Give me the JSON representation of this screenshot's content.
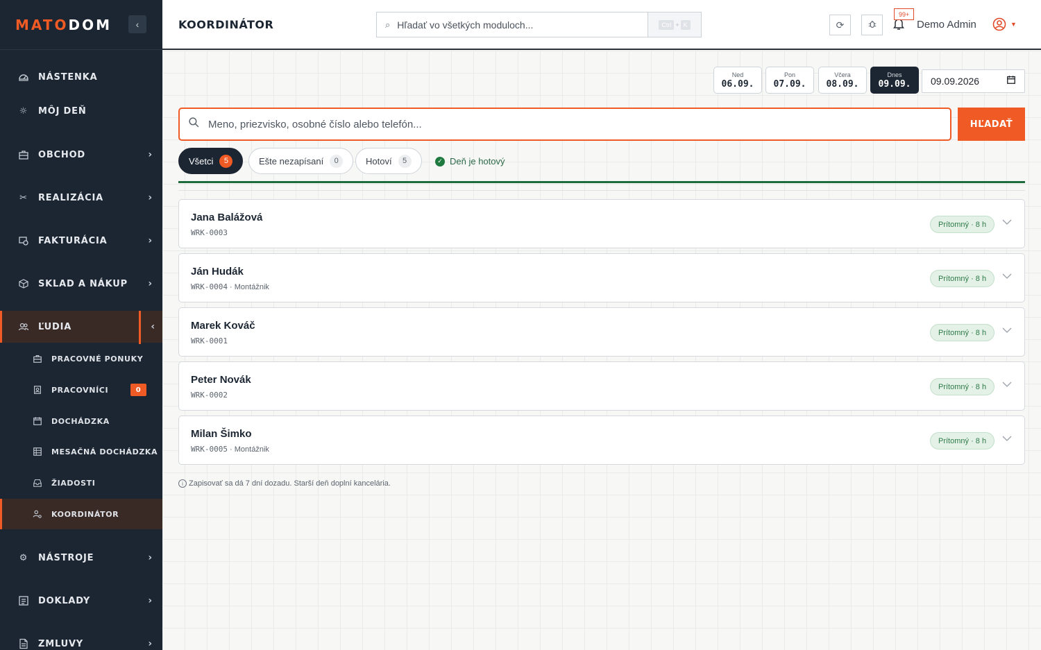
{
  "brand": {
    "prefix": "MATO",
    "suffix": "DOM"
  },
  "sidebar": {
    "collapse_icon": "chevron-left-icon",
    "items": [
      {
        "label": "NÁSTENKA",
        "icon": "dashboard-icon"
      },
      {
        "label": "MÔJ DEŇ",
        "icon": "sun-icon"
      },
      {
        "label": "OBCHOD",
        "icon": "briefcase-icon"
      },
      {
        "label": "REALIZÁCIA",
        "icon": "tools-icon"
      },
      {
        "label": "FAKTURÁCIA",
        "icon": "invoice-icon"
      },
      {
        "label": "SKLAD A NÁKUP",
        "icon": "box-icon"
      },
      {
        "label": "ĽUDIA",
        "icon": "people-icon"
      },
      {
        "label": "NÁSTROJE",
        "icon": "gear-icon"
      },
      {
        "label": "DOKLADY",
        "icon": "list-icon"
      },
      {
        "label": "ZMLUVY",
        "icon": "document-icon"
      }
    ],
    "subitems": [
      {
        "label": "PRACOVNÉ PONUKY",
        "icon": "briefcase-icon"
      },
      {
        "label": "PRACOVNÍCI",
        "icon": "id-badge-icon",
        "badge": "0"
      },
      {
        "label": "DOCHÁDZKA",
        "icon": "calendar-icon"
      },
      {
        "label": "MESAČNÁ DOCHÁDZKA",
        "icon": "table-icon"
      },
      {
        "label": "ŽIADOSTI",
        "icon": "inbox-icon"
      },
      {
        "label": "KOORDINÁTOR",
        "icon": "user-cog-icon"
      }
    ]
  },
  "header": {
    "title": "KOORDINÁTOR",
    "search_placeholder": "Hľadať vo všetkých moduloch...",
    "shortcut": [
      "Ctrl",
      "K"
    ],
    "notifications": "99+",
    "user": "Demo Admin"
  },
  "date_nav": {
    "days": [
      {
        "name": "Ned",
        "date": "06.09."
      },
      {
        "name": "Pon",
        "date": "07.09."
      },
      {
        "name": "Včera",
        "date": "08.09."
      },
      {
        "name": "Dnes",
        "date": "09.09."
      }
    ],
    "selected_date": "09.09.2026"
  },
  "search": {
    "placeholder": "Meno, priezvisko, osobné číslo alebo telefón...",
    "button": "HĽADAŤ"
  },
  "filters": [
    {
      "label": "Všetci",
      "count": "5"
    },
    {
      "label": "Ešte nezapísaní",
      "count": "0"
    },
    {
      "label": "Hotoví",
      "count": "5"
    }
  ],
  "day_status": "Deň je hotový",
  "progress_fraction": 1.0,
  "workers": [
    {
      "name": "Jana Balážová",
      "code": "WRK-0003",
      "role": "",
      "status": "Prítomný · 8 h"
    },
    {
      "name": "Ján Hudák",
      "code": "WRK-0004",
      "role": " · Montážnik",
      "status": "Prítomný · 8 h"
    },
    {
      "name": "Marek Kováč",
      "code": "WRK-0001",
      "role": "",
      "status": "Prítomný · 8 h"
    },
    {
      "name": "Peter Novák",
      "code": "WRK-0002",
      "role": "",
      "status": "Prítomný · 8 h"
    },
    {
      "name": "Milan Šimko",
      "code": "WRK-0005",
      "role": " · Montážnik",
      "status": "Prítomný · 8 h"
    }
  ],
  "note": "Zapisovať sa dá 7 dní dozadu. Starší deň doplní kancelária.",
  "colors": {
    "accent": "#f05a24",
    "sidebar": "#1c2632",
    "success": "#1e6b3c"
  }
}
